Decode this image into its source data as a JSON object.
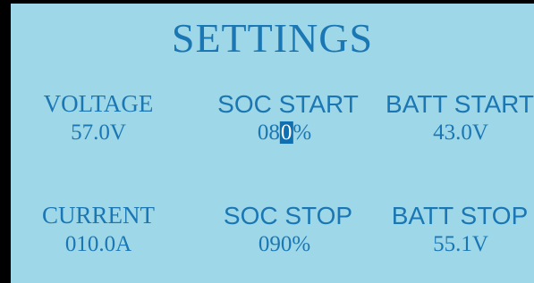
{
  "screen": {
    "title": "SETTINGS",
    "voltage": {
      "label": "VOLTAGE",
      "value": "57.0V"
    },
    "soc_start": {
      "label": "SOC START",
      "value_prefix": "08",
      "value_cursor": "0",
      "value_suffix": "%"
    },
    "batt_start": {
      "label": "BATT START",
      "value": "43.0V"
    },
    "current": {
      "label": "CURRENT",
      "value": "010.0A"
    },
    "soc_stop": {
      "label": "SOC STOP",
      "value": "090%"
    },
    "batt_stop": {
      "label": "BATT STOP",
      "value": "55.1V"
    }
  },
  "colors": {
    "background": "#9ed7e8",
    "text": "#1b77b3",
    "cursor": "#0f6fb0",
    "frame": "#000000"
  }
}
